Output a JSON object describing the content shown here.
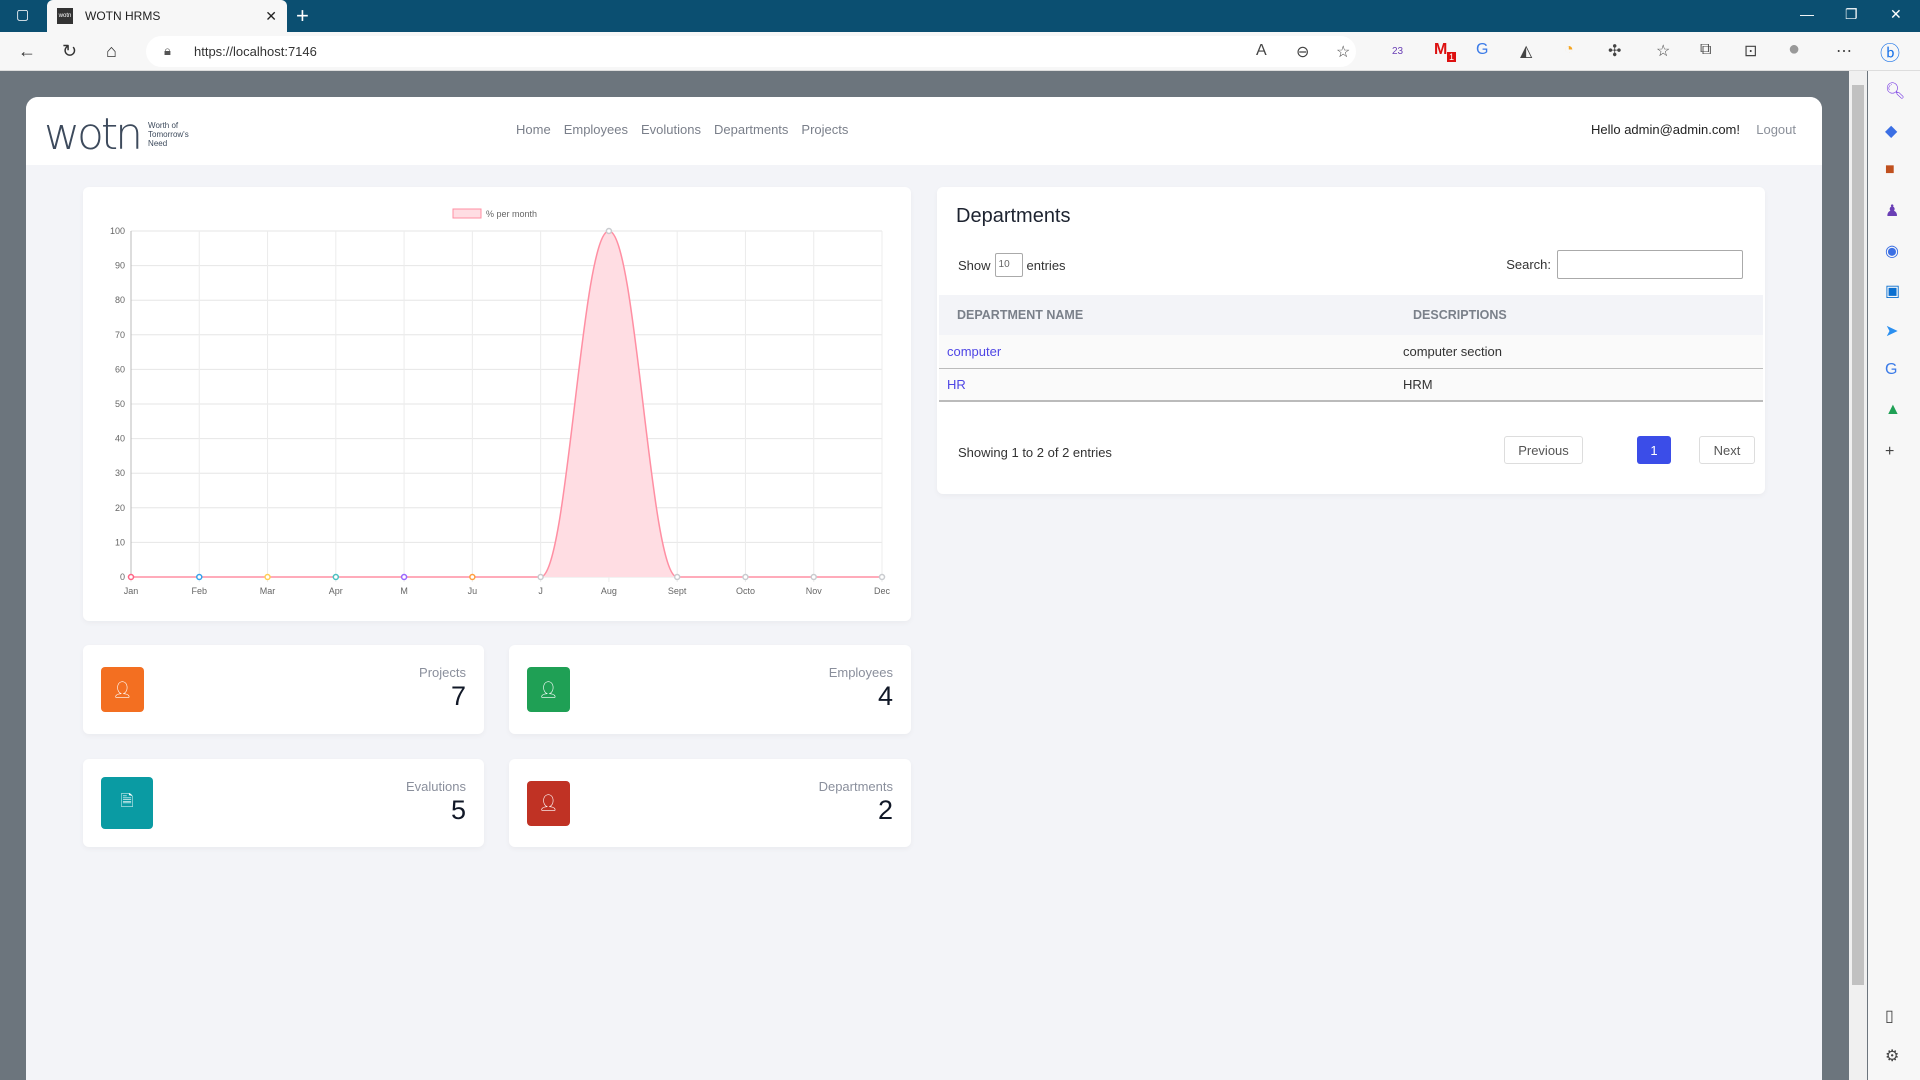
{
  "browser": {
    "tab_title": "WOTN HRMS",
    "url": "https://localhost:7146",
    "badges": {
      "ext1": "23",
      "gmail": "1"
    }
  },
  "header": {
    "logo_text": "wotn",
    "logo_tagline": "Worth of Tomorrow's Need",
    "nav": [
      "Home",
      "Employees",
      "Evolutions",
      "Departments",
      "Projects"
    ],
    "greeting": "Hello admin@admin.com!",
    "logout": "Logout"
  },
  "chart_data": {
    "type": "area",
    "legend": "% per month",
    "legend_placement": "top",
    "x": [
      "Jan",
      "Feb",
      "Mar",
      "Apr",
      "M",
      "Ju",
      "J",
      "Aug",
      "Sept",
      "Octo",
      "Nov",
      "Dec"
    ],
    "values": [
      0,
      0,
      0,
      0,
      0,
      0,
      0,
      100,
      0,
      0,
      0,
      0
    ],
    "ylim": [
      0,
      100
    ],
    "yticks": [
      0,
      10,
      20,
      30,
      40,
      50,
      60,
      70,
      80,
      90,
      100
    ],
    "grid": true,
    "line_color": "#ff8fa3",
    "fill_color": "#ffdde3",
    "point_colors": [
      "#ff6384",
      "#36a2eb",
      "#ffce56",
      "#4bc0c0",
      "#9966ff",
      "#ff9f40",
      "#c9cbcf",
      "#c9cbcf",
      "#c9cbcf",
      "#c9cbcf",
      "#c9cbcf",
      "#c9cbcf"
    ]
  },
  "departments": {
    "title": "Departments",
    "show_label": "Show",
    "show_value": "10",
    "entries_label": "entries",
    "search_label": "Search:",
    "search_value": "",
    "columns": [
      "DEPARTMENT NAME",
      "DESCRIPTIONS"
    ],
    "rows": [
      {
        "name": "computer",
        "description": "computer section"
      },
      {
        "name": "HR",
        "description": "HRM"
      }
    ],
    "info": "Showing 1 to 2 of 2 entries",
    "prev": "Previous",
    "page": "1",
    "next": "Next",
    "accent": "#3b4de8"
  },
  "stats": [
    {
      "label": "Projects",
      "value": "7",
      "color": "#f36f21",
      "icon": "user-icon"
    },
    {
      "label": "Employees",
      "value": "4",
      "color": "#1fa055",
      "icon": "user-icon"
    },
    {
      "label": "Evalutions",
      "value": "5",
      "color": "#0a9ba3",
      "icon": "document-icon"
    },
    {
      "label": "Departments",
      "value": "2",
      "color": "#c03224",
      "icon": "user-icon"
    }
  ]
}
